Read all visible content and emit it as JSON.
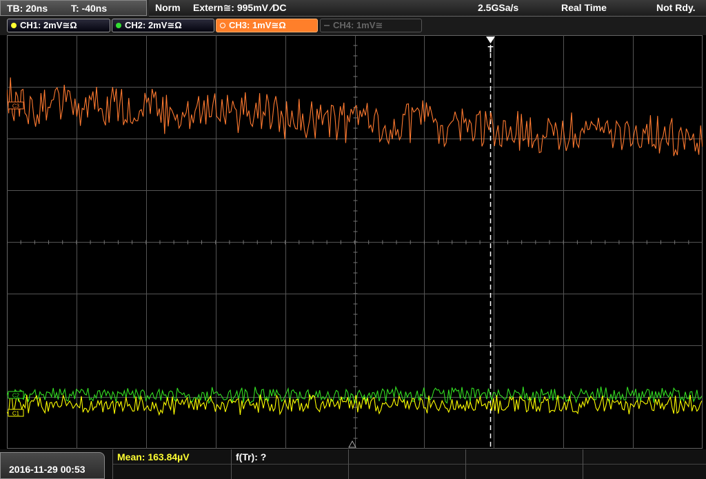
{
  "topbar": {
    "timebase": "TB: 20ns",
    "trigger_offset": "T: -40ns",
    "trigger_mode": "Norm",
    "trigger_source": "Extern≅: 995mV ⁄DC",
    "sample_rate": "2.5GSa/s",
    "acq_mode": "Real Time",
    "status": "Not Rdy."
  },
  "channels": [
    {
      "label": "CH1: 2mV≅Ω",
      "color": "#ffff33"
    },
    {
      "label": "CH2: 2mV≅Ω",
      "color": "#33dd33"
    },
    {
      "label": "CH3: 1mV≅Ω",
      "color": "#ff7f2a"
    },
    {
      "label": "CH4: 1mV≅",
      "color": "#777777"
    }
  ],
  "markers": {
    "trigger": "T",
    "ch3": "C3",
    "ch2": "C2",
    "ch1": "C1"
  },
  "bottom": {
    "datetime": "2016-11-29 00:53",
    "meas1": "Mean: 163.84µV",
    "meas2": "f(Tr): ?"
  },
  "colors": {
    "ch1": "#ffff00",
    "ch2": "#33dd22",
    "ch3": "#ff7a30",
    "grid": "#555555",
    "meas1_text": "#ffff33"
  }
}
